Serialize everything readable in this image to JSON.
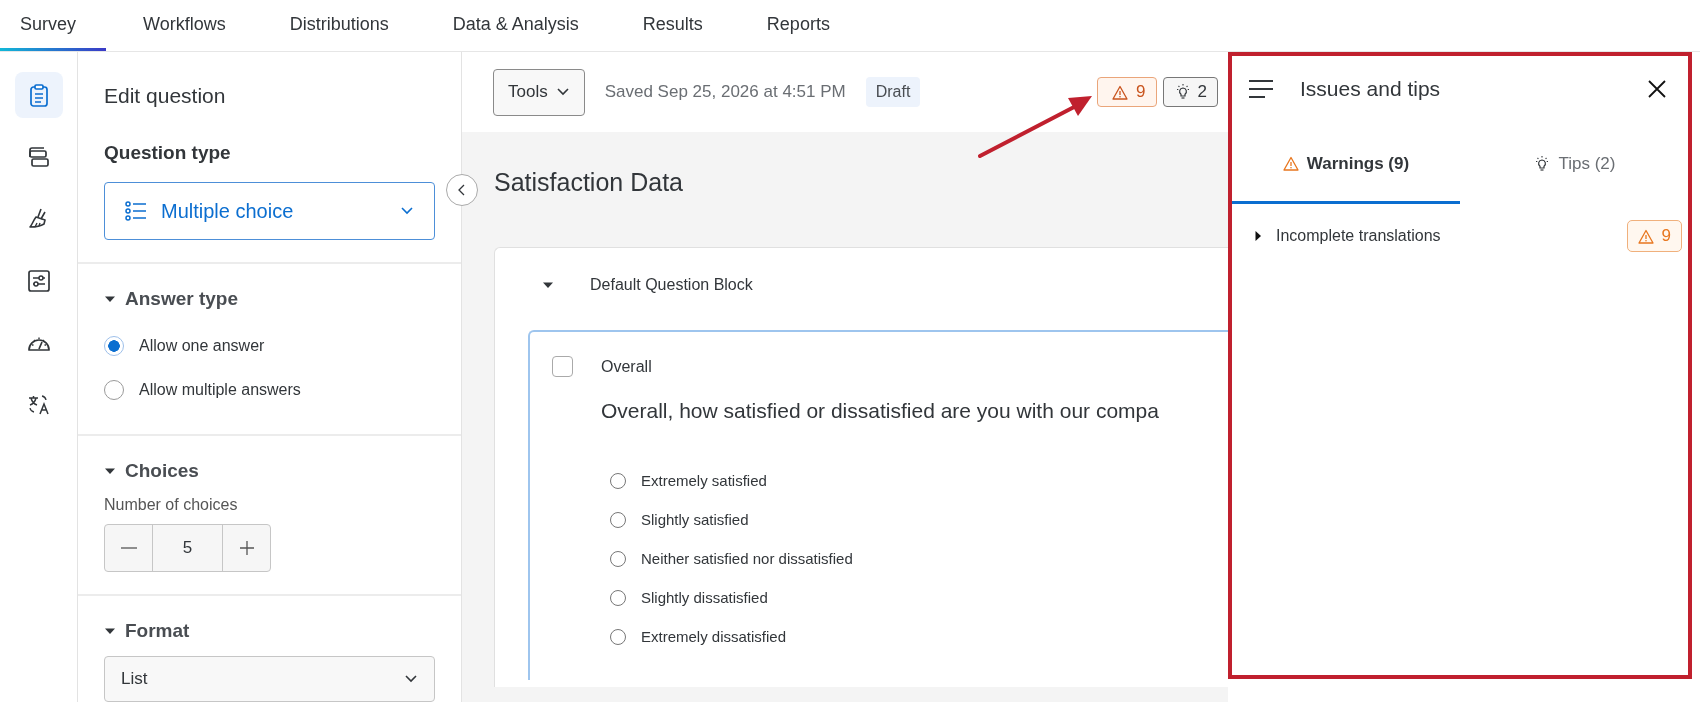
{
  "top_nav": {
    "tabs": [
      {
        "label": "Survey",
        "selected": true
      },
      {
        "label": "Workflows",
        "selected": false
      },
      {
        "label": "Distributions",
        "selected": false
      },
      {
        "label": "Data & Analysis",
        "selected": false
      },
      {
        "label": "Results",
        "selected": false
      },
      {
        "label": "Reports",
        "selected": false
      }
    ]
  },
  "icon_rail": {
    "items": [
      {
        "selected": true
      },
      {
        "selected": false
      },
      {
        "selected": false
      },
      {
        "selected": false
      },
      {
        "selected": false
      },
      {
        "selected": false
      }
    ]
  },
  "edit_panel": {
    "title": "Edit question",
    "question_type": {
      "label": "Question type",
      "value": "Multiple choice"
    },
    "sections": [
      {
        "kind": "radios",
        "title": "Answer type",
        "expanded": true,
        "options": [
          {
            "label": "Allow one answer",
            "selected": true
          },
          {
            "label": "Allow multiple answers",
            "selected": false
          }
        ]
      },
      {
        "kind": "stepper",
        "title": "Choices",
        "expanded": true,
        "label": "Number of choices",
        "value": "5"
      },
      {
        "kind": "dropdown",
        "title": "Format",
        "expanded": true,
        "value": "List"
      }
    ]
  },
  "toolbar": {
    "tools_button": "Tools",
    "saved": "Saved Sep 25, 2026 at 4:51 PM",
    "status": "Draft",
    "warnings_count": "9",
    "tips_count": "2"
  },
  "survey": {
    "title": "Satisfaction Data",
    "blocks": [
      {
        "title": "Default Question Block",
        "expanded": true,
        "questions": [
          {
            "tag": "Overall",
            "checked": false,
            "text": "Overall, how satisfied or dissatisfied are you with our compa",
            "choices": [
              {
                "label": "Extremely satisfied",
                "selected": false
              },
              {
                "label": "Slightly satisfied",
                "selected": false
              },
              {
                "label": "Neither satisfied nor dissatisfied",
                "selected": false
              },
              {
                "label": "Slightly dissatisfied",
                "selected": false
              },
              {
                "label": "Extremely dissatisfied",
                "selected": false
              }
            ]
          }
        ]
      }
    ]
  },
  "issues_panel": {
    "title": "Issues and tips",
    "tabs": [
      {
        "kind": "warning",
        "label": "Warnings (9)",
        "selected": true
      },
      {
        "kind": "tip",
        "label": "Tips (2)",
        "selected": false
      }
    ],
    "issues": [
      {
        "label": "Incomplete translations",
        "expanded": false,
        "count": "9"
      }
    ]
  }
}
